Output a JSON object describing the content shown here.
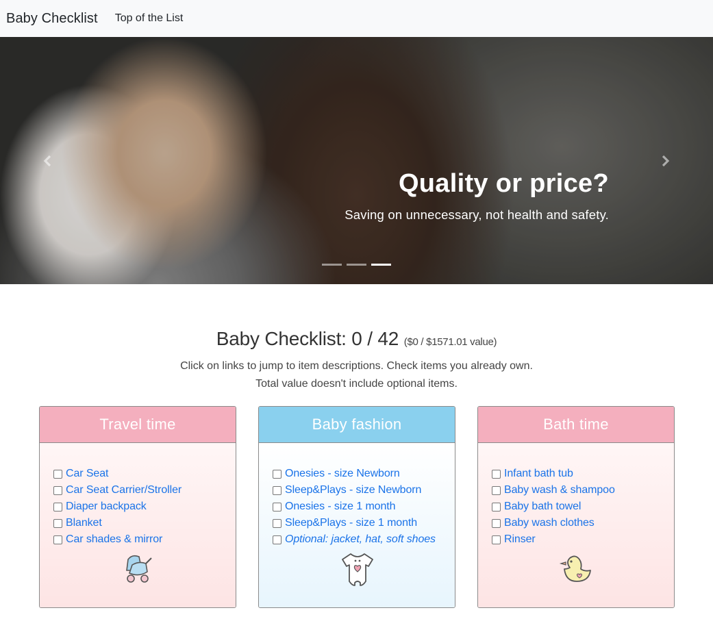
{
  "navbar": {
    "brand": "Baby Checklist",
    "links": [
      "Top of the List"
    ]
  },
  "carousel": {
    "caption_title": "Quality or price?",
    "caption_text": "Saving on unnecessary, not health and safety.",
    "indicator_count": 3,
    "active_indicator": 3,
    "prev_icon": "chevron-left-icon",
    "next_icon": "chevron-right-icon"
  },
  "summary": {
    "title": "Baby Checklist: 0 / 42",
    "value": "($0 / $1571.01 value)",
    "line1": "Click on links to jump to item descriptions. Check items you already own.",
    "line2": "Total value doesn't include optional items."
  },
  "cards": [
    {
      "title": "Travel time",
      "color": "#f4afbe",
      "icon": "stroller-icon",
      "items": [
        "Car Seat",
        "Car Seat Carrier/Stroller",
        "Diaper backpack",
        "Blanket",
        "Car shades & mirror"
      ]
    },
    {
      "title": "Baby fashion",
      "color": "#8ad0ee",
      "icon": "onesie-icon",
      "items": [
        "Onesies - size Newborn",
        "Sleep&Plays - size Newborn",
        "Onesies - size 1 month",
        "Sleep&Plays - size 1 month",
        "Optional: jacket, hat, soft shoes"
      ]
    },
    {
      "title": "Bath time",
      "color": "#f4afbe",
      "icon": "rubber-duck-icon",
      "items": [
        "Infant bath tub",
        "Baby wash & shampoo",
        "Baby bath towel",
        "Baby wash clothes",
        "Rinser"
      ]
    }
  ],
  "colors": {
    "link": "#1a73e8",
    "navbar_bg": "#f8f9fa"
  }
}
